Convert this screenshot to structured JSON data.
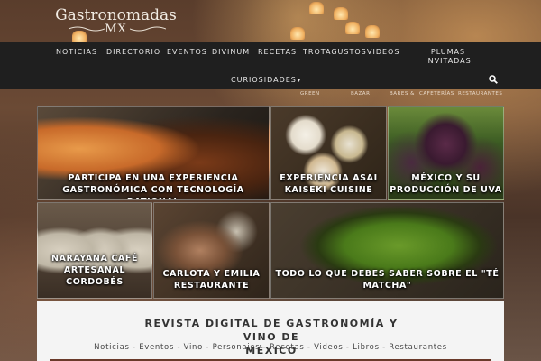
{
  "site": {
    "logo_line1": "Gastronomadas",
    "logo_line2": "MX"
  },
  "nav": {
    "items": [
      {
        "label": "NOTICIAS"
      },
      {
        "label": "DIRECTORIO"
      },
      {
        "label": "EVENTOS"
      },
      {
        "label": "DIVINUM"
      },
      {
        "label": "RECETAS"
      },
      {
        "label": "TROTAGUSTOS"
      },
      {
        "label": "VIDEOS"
      },
      {
        "label_line1": "PLUMAS",
        "label_line2": "INVITADAS"
      },
      {
        "label": "CURIOSIDADES",
        "caret": "▾"
      }
    ],
    "search_icon": "search-icon"
  },
  "subnav": {
    "items": [
      "GREEN",
      "BAZAR",
      "BARES &",
      "CAFETERÍAS",
      "RESTAURANTES"
    ]
  },
  "tiles": [
    {
      "line1": "PARTICIPA EN UNA EXPERIENCIA",
      "line2": "GASTRONÓMICA CON TECNOLOGÍA RATIONAL"
    },
    {
      "line1": "EXPERIENCIA ASAI",
      "line2": "KAISEKI CUISINE"
    },
    {
      "line1": "MÉXICO Y SU",
      "line2": "PRODUCCIÓN DE UVA"
    },
    {
      "line1": "NARAYANA CAFÉ",
      "line2": "ARTESANAL",
      "line3": "CORDOBÉS"
    },
    {
      "line1": "CARLOTA Y EMILIA",
      "line2": "RESTAURANTE"
    },
    {
      "line1": "TODO LO QUE DEBES SABER SOBRE EL \"TÉ",
      "line2": "MATCHA\""
    }
  ],
  "footer": {
    "title_line1": "REVISTA DIGITAL DE GASTRONOMÍA Y VINO DE",
    "title_line2": "MÉXICO",
    "links": "Noticias - Eventos - Vino - Personajes - Recetas - Videos - Libros - Restaurantes"
  }
}
